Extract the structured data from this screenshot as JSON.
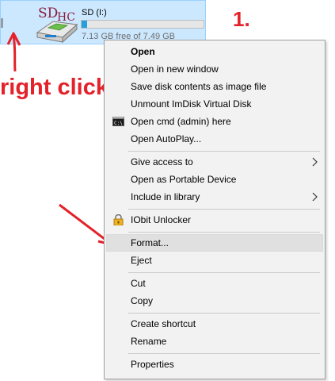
{
  "drive": {
    "name": "SD (I:)",
    "free_text": "7.13 GB free of 7.49 GB",
    "used_fraction": 0.048,
    "icon": "sdhc-card-icon",
    "icon_text": "SDHC"
  },
  "annotations": {
    "step": "1.",
    "right_click": "right click",
    "color": "#e3222a"
  },
  "menu": {
    "open": "Open",
    "open_new_window": "Open in new window",
    "save_image": "Save disk contents as image file",
    "unmount": "Unmount ImDisk Virtual Disk",
    "open_cmd": "Open cmd (admin) here",
    "open_autoplay": "Open AutoPlay...",
    "give_access": "Give access to",
    "portable_device": "Open as Portable Device",
    "include_library": "Include in library",
    "iobit": "IObit Unlocker",
    "format": "Format...",
    "eject": "Eject",
    "cut": "Cut",
    "copy": "Copy",
    "create_shortcut": "Create shortcut",
    "rename": "Rename",
    "properties": "Properties"
  },
  "colors": {
    "accent": "#26a0da",
    "selection": "#cce8ff",
    "menu_bg": "#f2f2f2"
  }
}
